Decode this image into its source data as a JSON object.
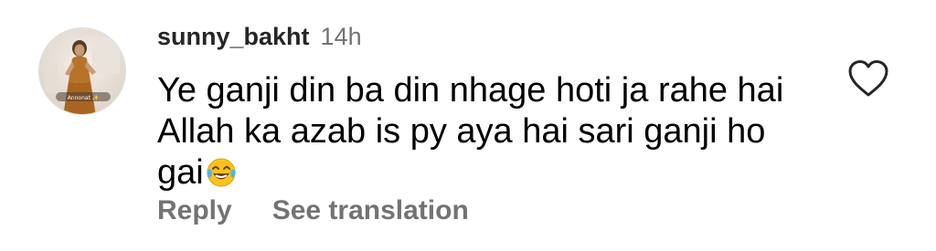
{
  "comment": {
    "username": "sunny_bakht",
    "time": "14h",
    "lines": [
      "Ye ganji din ba din nhage hoti ja rahe hai",
      "Allah ka azab is py aya hai sari ganji ho",
      "gai"
    ],
    "emoji": "face-with-tears-of-joy",
    "avatar_caption": "Annonat ✨",
    "actions": {
      "reply": "Reply",
      "see_translation": "See translation"
    },
    "like_icon": "heart-outline-icon"
  },
  "colors": {
    "username": "#262626",
    "secondary_text": "#737373",
    "body_text": "#000000",
    "background": "#ffffff"
  }
}
